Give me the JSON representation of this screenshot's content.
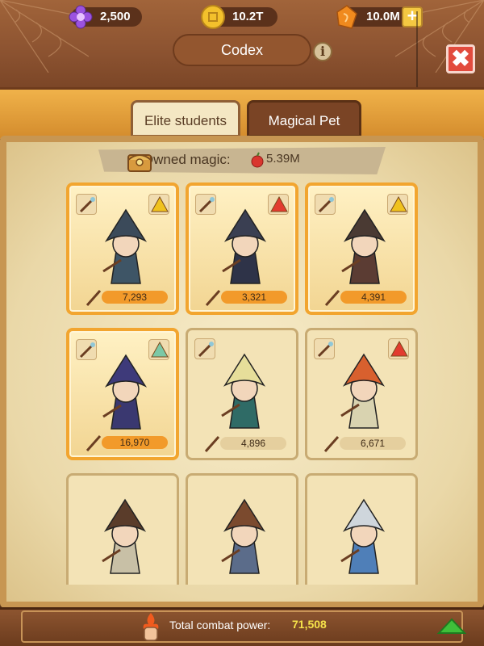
{
  "resources": [
    {
      "icon": "flower-gem-icon",
      "value": "2,500",
      "color": "#9b52e0"
    },
    {
      "icon": "gold-coin-icon",
      "value": "10.2T",
      "color": "#f3c12c"
    },
    {
      "icon": "amber-crystal-icon",
      "value": "10.0M",
      "color": "#f08a1e"
    }
  ],
  "header": {
    "title": "Codex",
    "info_label": "i",
    "close_label": "✖"
  },
  "tabs": [
    {
      "label": "Elite students",
      "active": true
    },
    {
      "label": "Magical Pet",
      "active": false
    }
  ],
  "owned": {
    "label": "Owned magic:",
    "value": "5.39M"
  },
  "cards": [
    {
      "power": "7,293",
      "style": "gold",
      "badge_color": "#f0c21e",
      "hat": "#3b4a5a",
      "robe": "#3e5566"
    },
    {
      "power": "3,321",
      "style": "gold",
      "badge_color": "#e23b2f",
      "hat": "#3a3f52",
      "robe": "#2e3348"
    },
    {
      "power": "4,391",
      "style": "gold",
      "badge_color": "#f0c21e",
      "hat": "#4a3a33",
      "robe": "#5b3c33"
    },
    {
      "power": "16,970",
      "style": "gold",
      "badge_color": "#7bc8a6",
      "hat": "#3e3a7a",
      "robe": "#3a3870"
    },
    {
      "power": "4,896",
      "style": "plain",
      "badge_color": "",
      "hat": "#e6de9a",
      "robe": "#2f6b66"
    },
    {
      "power": "6,671",
      "style": "plain",
      "badge_color": "#e23b2f",
      "hat": "#d8602e",
      "robe": "#d9d3b0"
    },
    {
      "power": "",
      "style": "plain",
      "badge_color": "",
      "hat": "#5a3c2a",
      "robe": "#c8c0a6"
    },
    {
      "power": "",
      "style": "plain",
      "badge_color": "",
      "hat": "#7b4a2e",
      "robe": "#5b6c8a"
    },
    {
      "power": "",
      "style": "plain",
      "badge_color": "",
      "hat": "#cfd6dc",
      "robe": "#4f7fb8"
    }
  ],
  "footer": {
    "label": "Total combat power:",
    "value": "71,508"
  }
}
